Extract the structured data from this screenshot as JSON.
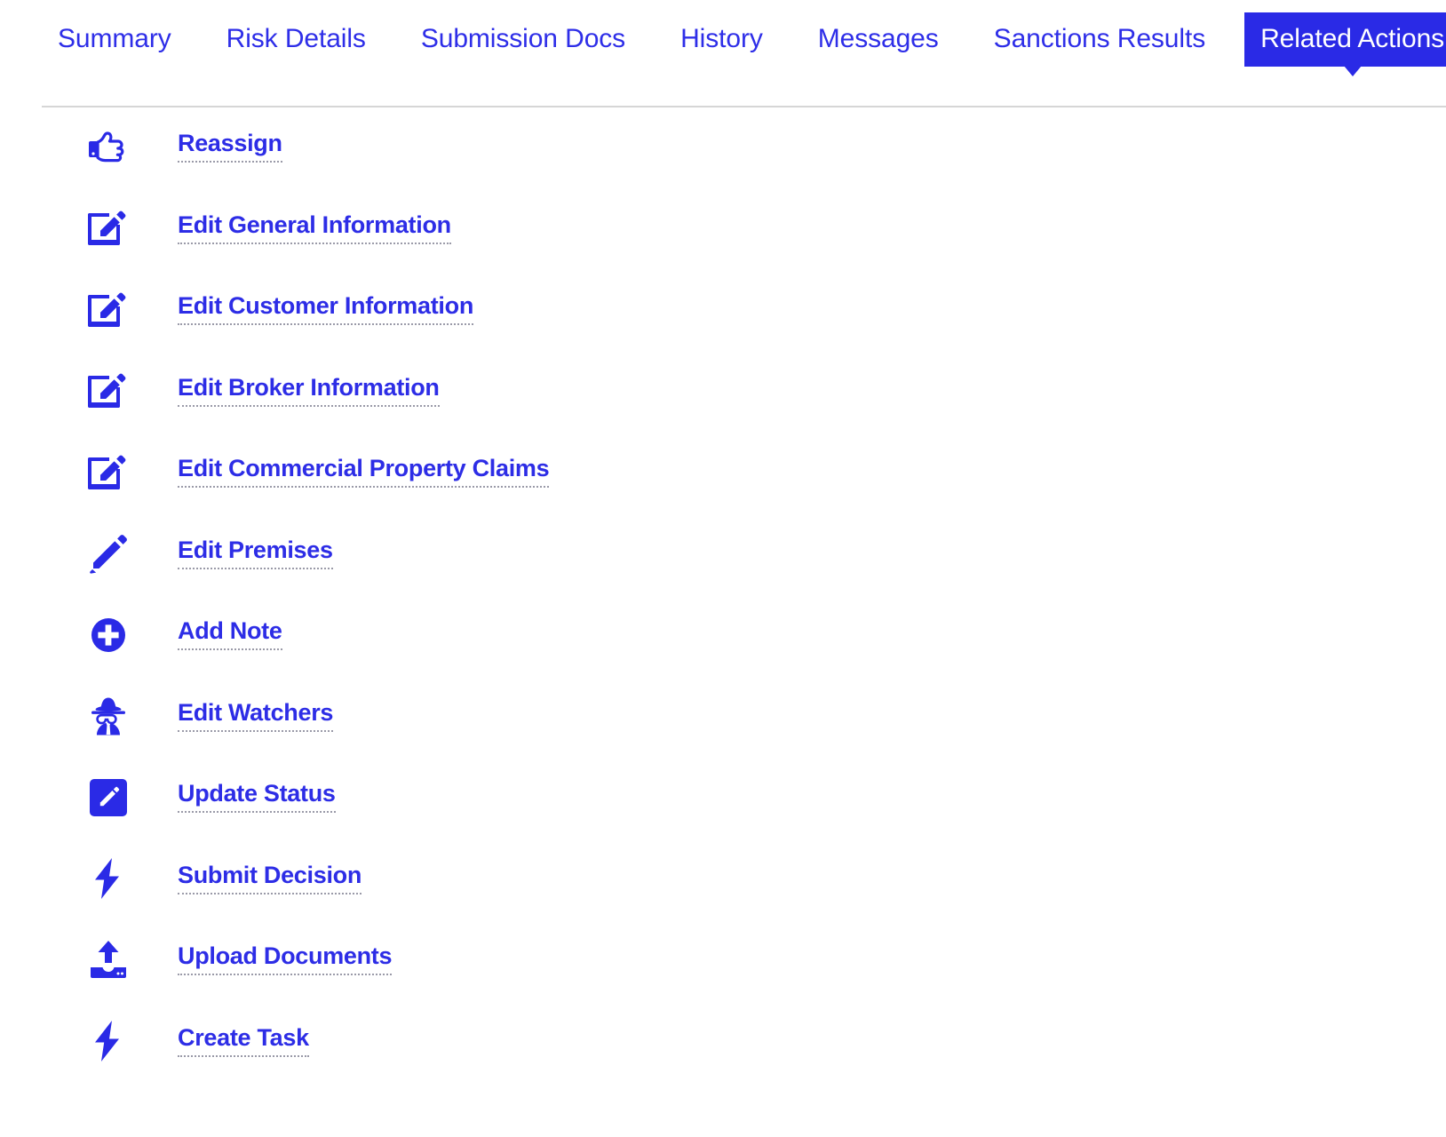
{
  "colors": {
    "accent": "#2a2ae6",
    "link": "#2e2ee8",
    "rule": "#d6d6d6",
    "dotted_underline": "#9a9aa8",
    "background": "#ffffff",
    "active_tab_text": "#ffffff"
  },
  "tabs": [
    {
      "label": "Summary",
      "name": "tab-summary",
      "active": false
    },
    {
      "label": "Risk Details",
      "name": "tab-risk-details",
      "active": false
    },
    {
      "label": "Submission Docs",
      "name": "tab-submission-docs",
      "active": false
    },
    {
      "label": "History",
      "name": "tab-history",
      "active": false
    },
    {
      "label": "Messages",
      "name": "tab-messages",
      "active": false
    },
    {
      "label": "Sanctions Results",
      "name": "tab-sanctions-results",
      "active": false
    },
    {
      "label": "Related Actions",
      "name": "tab-related-actions",
      "active": true
    }
  ],
  "actions": [
    {
      "label": "Reassign",
      "icon": "pointing-hand-icon"
    },
    {
      "label": "Edit General Information",
      "icon": "edit-square-pencil-icon"
    },
    {
      "label": "Edit Customer Information",
      "icon": "edit-square-pencil-icon"
    },
    {
      "label": "Edit Broker Information",
      "icon": "edit-square-pencil-icon"
    },
    {
      "label": "Edit Commercial Property Claims",
      "icon": "edit-square-pencil-icon"
    },
    {
      "label": "Edit Premises",
      "icon": "pencil-icon"
    },
    {
      "label": "Add Note",
      "icon": "plus-circle-icon"
    },
    {
      "label": "Edit Watchers",
      "icon": "spy-detective-icon"
    },
    {
      "label": "Update Status",
      "icon": "filled-square-pencil-icon"
    },
    {
      "label": "Submit Decision",
      "icon": "lightning-bolt-icon"
    },
    {
      "label": "Upload Documents",
      "icon": "upload-tray-icon"
    },
    {
      "label": "Create Task",
      "icon": "lightning-bolt-icon"
    }
  ]
}
